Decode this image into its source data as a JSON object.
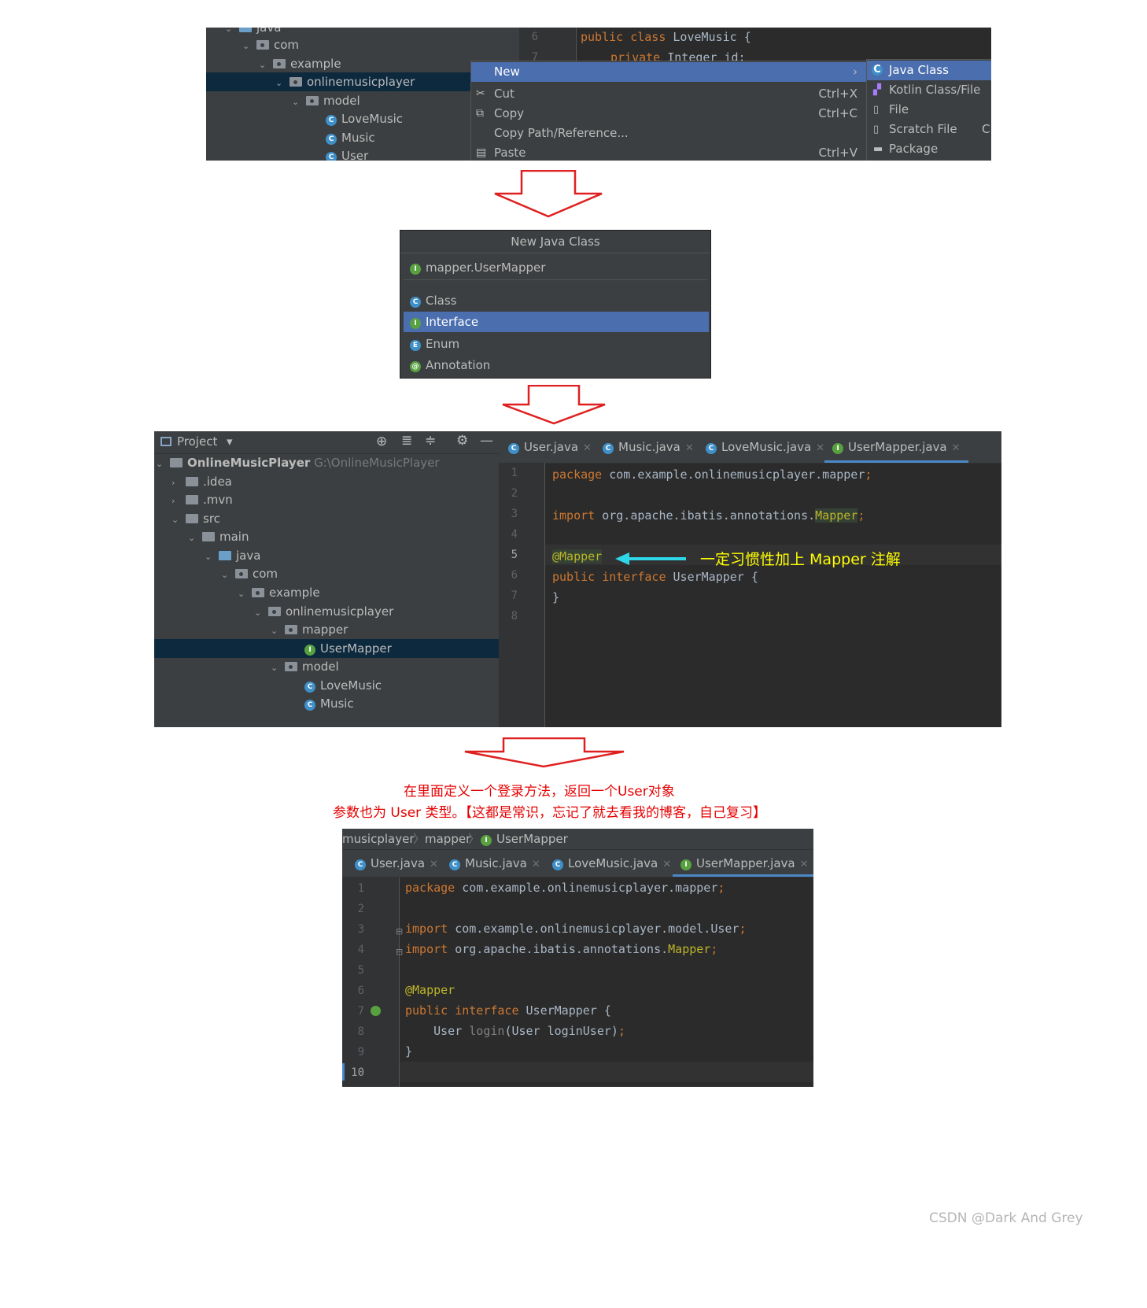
{
  "panel1": {
    "tree": [
      "java",
      "com",
      "example",
      "onlinemusicplayer",
      "model",
      "LoveMusic",
      "Music",
      "User"
    ],
    "editor_lines": [
      {
        "n": "6",
        "kw": "public class ",
        "txt": "LoveMusic {"
      },
      {
        "n": "7",
        "kw": "private ",
        "txt": "Integer id;"
      }
    ],
    "menu": [
      {
        "label": "New",
        "shortcut": "",
        "arrow": "›"
      },
      {
        "label": "Cut",
        "shortcut": "Ctrl+X"
      },
      {
        "label": "Copy",
        "shortcut": "Ctrl+C"
      },
      {
        "label": "Copy Path/Reference...",
        "shortcut": ""
      },
      {
        "label": "Paste",
        "shortcut": "Ctrl+V"
      }
    ],
    "submenu": [
      "Java Class",
      "Kotlin Class/File",
      "File",
      "Scratch File",
      "Package"
    ],
    "submenu_extra": "C"
  },
  "panel2": {
    "title": "New Java Class",
    "name_value": "mapper.UserMapper",
    "kinds": [
      "Class",
      "Interface",
      "Enum",
      "Annotation"
    ]
  },
  "panel3": {
    "toolbar_label": "Project",
    "root_name": "OnlineMusicPlayer",
    "root_path": "G:\\OnlineMusicPlayer",
    "tree": [
      ".idea",
      ".mvn",
      "src",
      "main",
      "java",
      "com",
      "example",
      "onlinemusicplayer",
      "mapper",
      "UserMapper",
      "model",
      "LoveMusic",
      "Music"
    ],
    "tabs": [
      "User.java",
      "Music.java",
      "LoveMusic.java",
      "UserMapper.java"
    ],
    "line_numbers": [
      "1",
      "2",
      "3",
      "4",
      "5",
      "6",
      "7",
      "8"
    ],
    "code": {
      "l1_kw": "package",
      "l1_txt": " com.example.onlinemusicplayer.mapper",
      "l3_kw": "import",
      "l3_txt": " org.apache.ibatis.annotations.",
      "l3_ann": "Mapper",
      "l5_ann": "@Mapper",
      "l6_kw": "public interface",
      "l6_txt": " UserMapper {",
      "l7_txt": "}"
    },
    "note": "一定习惯性加上 Mapper 注解"
  },
  "caption": {
    "line1": "在里面定义一个登录方法，返回一个User对象",
    "line2": "参数也为 User 类型。【这都是常识，忘记了就去看我的博客，自己复习】"
  },
  "panel4": {
    "breadcrumb": [
      "musicplayer",
      "mapper",
      "UserMapper"
    ],
    "tabs": [
      "User.java",
      "Music.java",
      "LoveMusic.java",
      "UserMapper.java"
    ],
    "line_numbers": [
      "1",
      "2",
      "3",
      "4",
      "5",
      "6",
      "7",
      "8",
      "9",
      "10"
    ],
    "code": {
      "l1_kw": "package",
      "l1_txt": " com.example.onlinemusicplayer.mapper",
      "l3_kw": "import",
      "l3_txt": " com.example.onlinemusicplayer.model.User",
      "l4_kw": "import",
      "l4_txt": " org.apache.ibatis.annotations.",
      "l4_ann": "Mapper",
      "l6_ann": "@Mapper",
      "l7_kw": "public interface",
      "l7_txt": " UserMapper {",
      "l8_a": "    User ",
      "l8_b": "login",
      "l8_c": "(User loginUser)",
      "l9_txt": "}"
    }
  },
  "watermark": "CSDN @Dark And Grey",
  "colors": {
    "arrow": "#e02020",
    "note": "#ffff00",
    "caption": "#e60000",
    "accent": "#4b6eaf"
  }
}
